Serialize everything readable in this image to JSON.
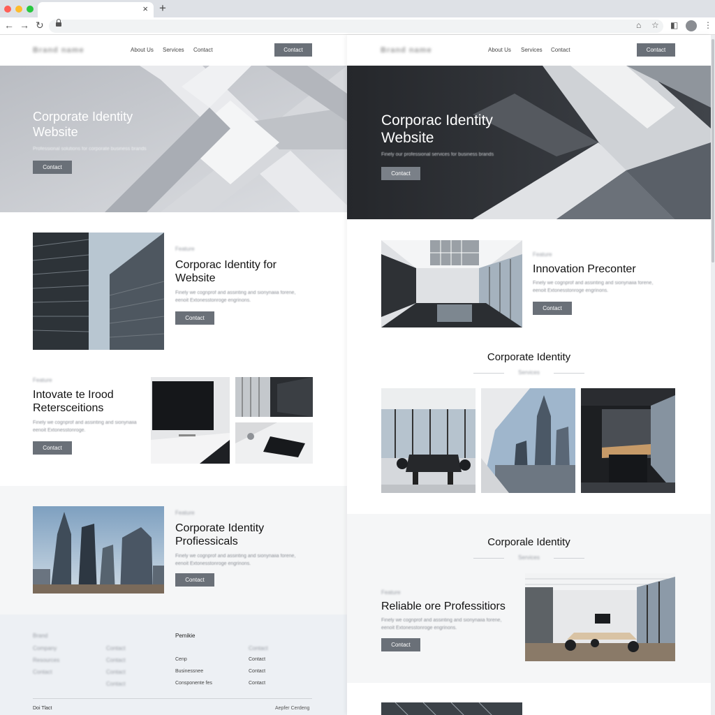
{
  "browser": {
    "tab_close": "×",
    "new_tab": "+",
    "back": "←",
    "forward": "→",
    "reload": "↻",
    "more": "⋮"
  },
  "left": {
    "logo": "Brand name",
    "nav": [
      "About Us",
      "Services",
      "Contact"
    ],
    "nav_cta": "Contact",
    "hero": {
      "title_line1": "Corporate Identity",
      "title_line2": "Website",
      "subtitle": "Professional solutions for corporate business brands",
      "cta": "Contact"
    },
    "section1": {
      "eyebrow": "Feature",
      "title_line1": "Corporac Identity for",
      "title_line2": "Website",
      "body_line1": "Finely we cognprof and assinting and sionynaiia forene,",
      "body_line2": "eenoit Extonesstonroge engrinons.",
      "cta": "Contact"
    },
    "section2": {
      "eyebrow": "Feature",
      "title_line1": "Intovate te Irood",
      "title_line2": "Retersceitions",
      "body_line1": "Finely we cognprof and assinting and sionynaiia",
      "body_line2": "eenoit Extonesstonroge.",
      "cta": "Contact"
    },
    "section3": {
      "eyebrow": "Feature",
      "title_line1": "Corporate Identity",
      "title_line2": "Profiessicals",
      "body_line1": "Finely we cognprof and assinting and sionynaiia forene,",
      "body_line2": "eenoit Extonesstonroge engrinons.",
      "cta": "Contact"
    },
    "footer": {
      "col1_title": "Brand",
      "col1_items": [
        "Company",
        "Resources",
        "Contact"
      ],
      "col2_title": "",
      "col2_items": [
        "Contact",
        "Contact",
        "Contact",
        "Contact"
      ],
      "col3_title": "Pemikie",
      "col3_items": [
        "Cenp",
        "Businessnee",
        "Consponente fes"
      ],
      "col4_title": "",
      "col4_items": [
        "Contact",
        "Contact",
        "Contact",
        "Contact"
      ],
      "bottom_left": "Doi Tlact",
      "bottom_right": "Aepfer Cerdeng"
    }
  },
  "right": {
    "logo": "Brand name",
    "nav": [
      "About Us",
      "Services",
      "Contact"
    ],
    "nav_cta": "Contact",
    "hero": {
      "title_line1": "Corporac Identity",
      "title_line2": "Website",
      "subtitle": "Finely our professional services for business brands",
      "cta": "Contact"
    },
    "section1": {
      "eyebrow": "Feature",
      "title": "Innovation Preconter",
      "body_line1": "Finely we cognprof and assinting and sionynaiia forene,",
      "body_line2": "eenoit Extonesstonroge engrinons.",
      "cta": "Contact"
    },
    "gallery": {
      "title": "Corporate Identity",
      "subtitle": "Services"
    },
    "section2": {
      "title": "Corporale Identity",
      "subtitle": "Services",
      "eyebrow": "Feature",
      "heading": "Reliable ore Professitiors",
      "body_line1": "Finely we cognprof and assinting and sionynaiia forene,",
      "body_line2": "eenoit Extonesstonroge engrinons.",
      "cta": "Contact"
    }
  }
}
